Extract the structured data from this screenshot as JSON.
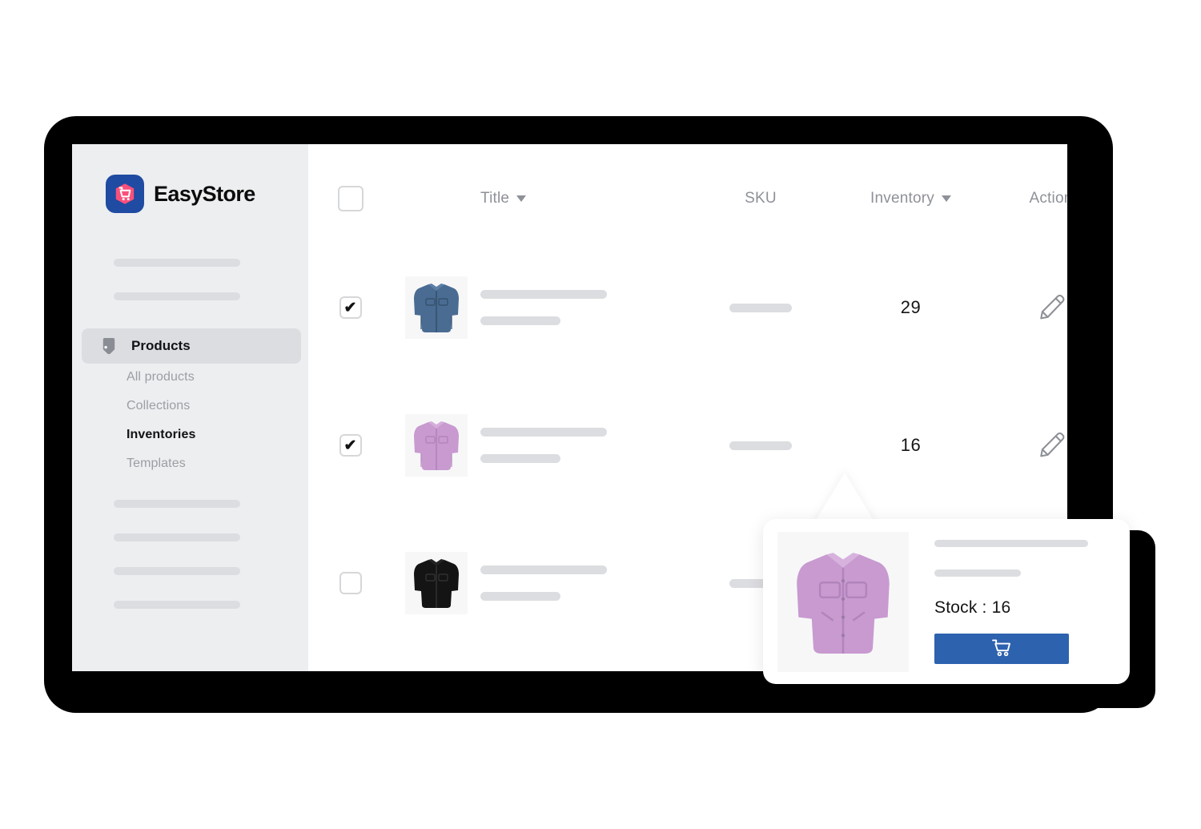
{
  "app": {
    "brand_name": "EasyStore",
    "logo_icon": "easystore-cart-shield-logo",
    "accent_blue": "#1f4ba2",
    "accent_pink": "#f9507b",
    "button_blue": "#2d62af",
    "sidebar_bg": "#edeef0",
    "skeleton_gray": "#dcdde0"
  },
  "sidebar": {
    "top_placeholders": 2,
    "bottom_placeholders": 4,
    "active_item": {
      "label": "Products",
      "icon": "tag-icon"
    },
    "sub_items": [
      {
        "label": "All products",
        "current": false
      },
      {
        "label": "Collections",
        "current": false
      },
      {
        "label": "Inventories",
        "current": true
      },
      {
        "label": "Templates",
        "current": false
      }
    ]
  },
  "table": {
    "headers": {
      "select_all": "",
      "title": "Title",
      "sku": "SKU",
      "inventory": "Inventory",
      "action": "Action",
      "sort_icon": "chevron-down-icon"
    },
    "select_all_checked": false,
    "rows": [
      {
        "checked": true,
        "check_glyph": "✔",
        "thumbnail": "blue-denim-jacket",
        "inventory": "29",
        "action_icon": "pencil-edit-icon"
      },
      {
        "checked": true,
        "check_glyph": "✔",
        "thumbnail": "pink-lilac-jacket",
        "inventory": "16",
        "action_icon": "pencil-edit-icon"
      },
      {
        "checked": false,
        "check_glyph": "",
        "thumbnail": "black-jacket",
        "inventory": "",
        "action_icon": ""
      }
    ]
  },
  "popup": {
    "thumbnail": "pink-lilac-jacket",
    "placeholder_lines": 2,
    "stock_label": "Stock : 16",
    "cart_button": {
      "icon": "shopping-cart-icon",
      "label": ""
    }
  }
}
